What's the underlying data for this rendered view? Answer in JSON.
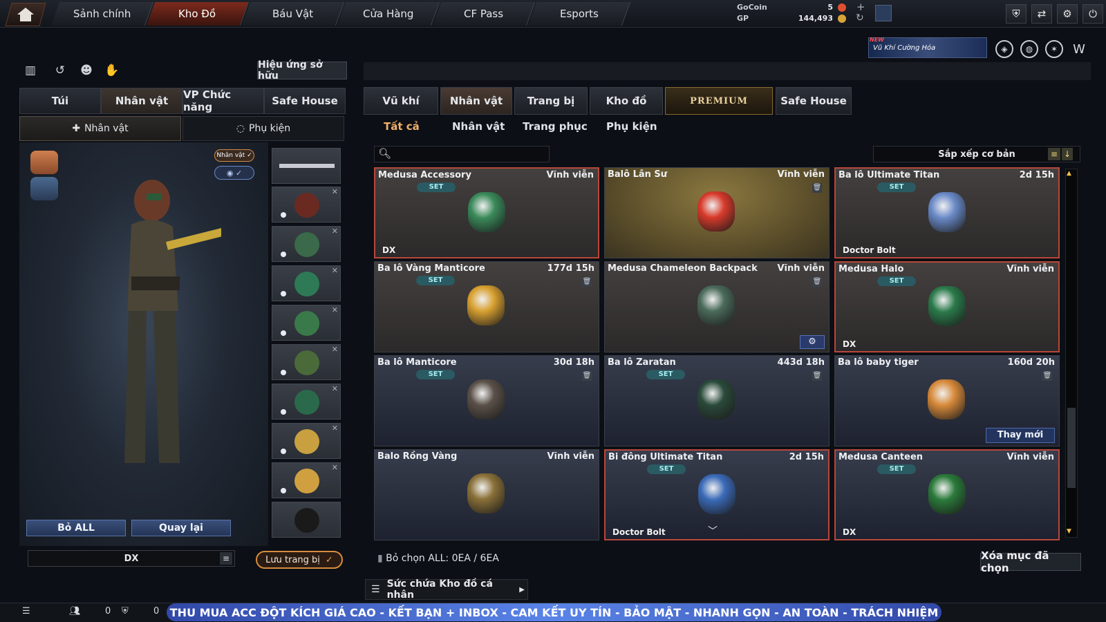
{
  "nav": {
    "tabs": [
      "Sảnh chính",
      "Kho Đồ",
      "Báu Vật",
      "Cửa Hàng",
      "CF Pass",
      "Esports"
    ],
    "active_index": 1
  },
  "currency": {
    "gocoin_label": "GoCoin",
    "gocoin_value": "5",
    "gp_label": "GP",
    "gp_value": "144,493"
  },
  "promo": {
    "new_label": "NEW",
    "text": "Vũ Khí Cường Hóa"
  },
  "left": {
    "effect_button": "Hiệu ứng sở hữu",
    "tabs": [
      "Túi",
      "Nhân vật",
      "VP Chức năng",
      "Safe House"
    ],
    "subtabs": [
      "Nhân vật",
      "Phụ kiện"
    ],
    "tag_character": "Nhân vật ✓",
    "clear_all": "Bỏ ALL",
    "back": "Quay lại",
    "preset": "DX",
    "save": "Lưu trang bị"
  },
  "right": {
    "tabs": [
      "Vũ khí",
      "Nhân vật",
      "Trang bị",
      "Kho đồ",
      "PREMIUM",
      "Safe House"
    ],
    "subtabs": [
      "Tất cả",
      "Nhân vật",
      "Trang phục",
      "Phụ kiện"
    ],
    "sort": "Sắp xếp cơ bản",
    "set_label": "SET",
    "change_label": "Thay mới",
    "items": [
      {
        "name": "Medusa Accessory",
        "duration": "Vĩnh viễn",
        "set": true,
        "footer": "DX",
        "selected": true,
        "style": "brown"
      },
      {
        "name": "Balô Lân Sư",
        "duration": "Vĩnh viễn",
        "set": false,
        "footer": "",
        "selected": false,
        "style": "gold"
      },
      {
        "name": "Ba lô Ultimate Titan",
        "duration": "2d 15h",
        "set": true,
        "footer": "Doctor Bolt",
        "selected": true,
        "style": "brown"
      },
      {
        "name": "Ba lô Vàng Manticore",
        "duration": "177d 15h",
        "set": true,
        "footer": "",
        "selected": false,
        "style": "brown"
      },
      {
        "name": "Medusa Chameleon Backpack",
        "duration": "Vĩnh viễn",
        "set": false,
        "footer": "",
        "selected": false,
        "style": "brown"
      },
      {
        "name": "Medusa Halo",
        "duration": "Vĩnh viễn",
        "set": true,
        "footer": "DX",
        "selected": true,
        "style": "brown"
      },
      {
        "name": "Ba lô Manticore",
        "duration": "30d 18h",
        "set": true,
        "footer": "",
        "selected": false,
        "style": "blue"
      },
      {
        "name": "Ba lô Zaratan",
        "duration": "443d 18h",
        "set": true,
        "footer": "",
        "selected": false,
        "style": "blue"
      },
      {
        "name": "Ba lô baby tiger",
        "duration": "160d 20h",
        "set": false,
        "footer": "",
        "selected": false,
        "style": "blue"
      },
      {
        "name": "Balo Rồng Vàng",
        "duration": "Vĩnh viễn",
        "set": false,
        "footer": "",
        "selected": false,
        "style": "blue"
      },
      {
        "name": "Bi đông Ultimate Titan",
        "duration": "2d 15h",
        "set": true,
        "footer": "Doctor Bolt",
        "selected": true,
        "style": "blue"
      },
      {
        "name": "Medusa Canteen",
        "duration": "Vĩnh viễn",
        "set": true,
        "footer": "DX",
        "selected": true,
        "style": "blue"
      }
    ],
    "deselect": "Bỏ chọn ALL: 0EA / 6EA",
    "delete_button": "Xóa mục đã chọn",
    "capacity": "Sức chứa Kho đồ cá nhân"
  },
  "bottom": {
    "friends_count": "0",
    "clan_count": "0",
    "banner": "THU MUA ACC ĐỘT KÍCH GIÁ CAO  -  KẾT BẠN + INBOX  -  CAM KẾT UY TÍN - BẢO MẬT - NHANH GỌN - AN TOÀN - TRÁCH NHIỆM"
  },
  "colors": {
    "accent": "#d88c3c",
    "selected_border": "#b8473a",
    "set_badge": "#2a5a62"
  }
}
